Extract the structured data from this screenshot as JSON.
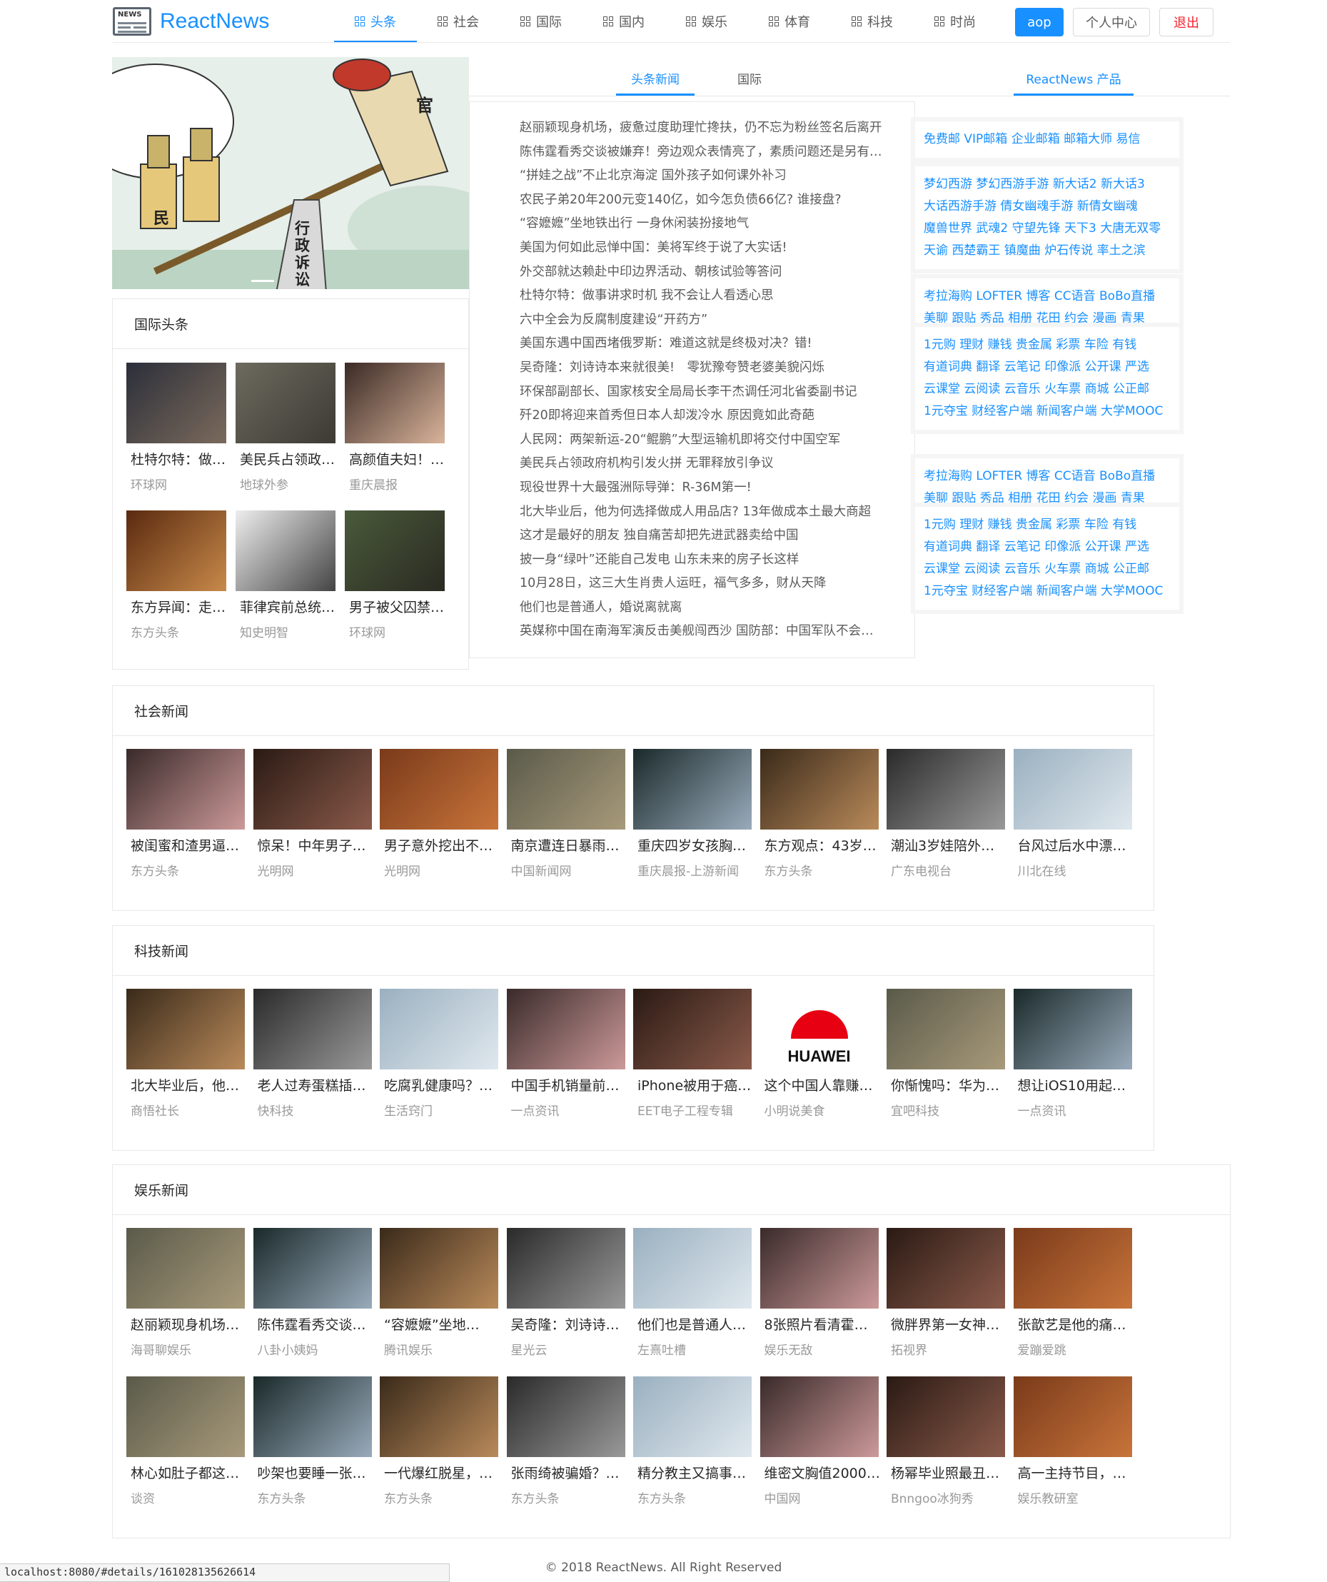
{
  "header": {
    "logo_badge": "NEWS",
    "logo_text": "ReactNews",
    "menu": [
      {
        "label": "头条",
        "active": true
      },
      {
        "label": "社会"
      },
      {
        "label": "国际"
      },
      {
        "label": "国内"
      },
      {
        "label": "娱乐"
      },
      {
        "label": "体育"
      },
      {
        "label": "科技"
      },
      {
        "label": "时尚"
      }
    ],
    "user_button": "aop",
    "center_button": "个人中心",
    "logout_button": "退出",
    "accent": "#1890ff"
  },
  "carousel": {
    "labels": [
      "官",
      "民",
      "行政诉讼"
    ]
  },
  "international": {
    "title": "国际头条",
    "items": [
      {
        "title": "杜特尔特：做…",
        "source": "环球网"
      },
      {
        "title": "美民兵占领政…",
        "source": "地球外参"
      },
      {
        "title": "高颜值夫妇！…",
        "source": "重庆晨报"
      },
      {
        "title": "东方异闻：走…",
        "source": "东方头条"
      },
      {
        "title": "菲律宾前总统…",
        "source": "知史明智"
      },
      {
        "title": "男子被父囚禁…",
        "source": "环球网"
      }
    ]
  },
  "center": {
    "tabs": [
      "头条新闻",
      "国际"
    ],
    "headlines": [
      "赵丽颖现身机场，疲惫过度助理忙搀扶，仍不忘为粉丝签名后离开",
      "陈伟霆看秀交谈被嫌弃！旁边观众表情亮了，素质问题还是另有隐情",
      "“拼娃之战”不止北京海淀 国外孩子如何课外补习",
      "农民子弟20年200元变140亿，如今怎负债66亿? 谁接盘?",
      "“容嬷嬷”坐地铁出行 一身休闲装扮接地气",
      "美国为何如此忌惮中国：美将军终于说了大实话!",
      "外交部就达赖赴中印边界活动、朝核试验等答问",
      "杜特尔特：做事讲求时机 我不会让人看透心思",
      "六中全会为反腐制度建设“开药方”",
      "美国东遇中国西堵俄罗斯：难道这就是终极对决？错!",
      "吴奇隆：刘诗诗本来就很美!　零犹豫夸赞老婆美貌闪烁",
      "环保部副部长、国家核安全局局长李干杰调任河北省委副书记",
      "歼20即将迎来首秀但日本人却泼冷水 原因竟如此奇葩",
      "人民网：两架新运-20“鲲鹏”大型运输机即将交付中国空军",
      "美民兵占领政府机构引发火拼 无罪释放引争议",
      "现役世界十大最强洲际导弹：R-36M第一!",
      "北大毕业后，他为何选择做成人用品店? 13年做成本土最大商超",
      "这才是最好的朋友 独自痛苦却把先进武器卖给中国",
      "披一身“绿叶”还能自己发电 山东未来的房子长这样",
      "10月28日，这三大生肖贵人运旺，福气多多，财从天降",
      "他们也是普通人，婚说离就离",
      "英媒称中国在南海军演反击美舰闯西沙 国防部：中国军队不会坐视不管"
    ]
  },
  "products": {
    "tab": "ReactNews 产品",
    "blocks": [
      [
        "免费邮  VIP邮箱  企业邮箱  邮箱大师  易信"
      ],
      [
        "梦幻西游  梦幻西游手游  新大话2  新大话3",
        "大话西游手游  倩女幽魂手游 新倩女幽魂",
        "魔兽世界 武魂2 守望先锋 天下3 大唐无双零",
        "天谕  西楚霸王 镇魔曲  炉石传说  率土之滨"
      ],
      [
        "考拉海购 LOFTER 博客 CC语音 BoBo直播",
        "美聊 跟贴 秀品 相册 花田 约会 漫画 青果"
      ],
      [
        "1元购  理财  赚钱  贵金属  彩票 车险 有钱",
        "有道词典  翻译  云笔记 印像派 公开课 严选",
        "云课堂  云阅读  云音乐 火车票 商城 公正邮",
        "1元夺宝  财经客户端 新闻客户端 大学MOOC"
      ],
      [
        "考拉海购 LOFTER 博客 CC语音 BoBo直播",
        "美聊 跟贴 秀品 相册 花田 约会 漫画 青果"
      ],
      [
        "1元购  理财  赚钱  贵金属  彩票 车险 有钱",
        "有道词典  翻译  云笔记 印像派 公开课 严选",
        "云课堂  云阅读  云音乐 火车票 商城 公正邮",
        "1元夺宝  财经客户端 新闻客户端 大学MOOC"
      ]
    ]
  },
  "social": {
    "title": "社会新闻",
    "items": [
      {
        "title": "被闺蜜和渣男逼…",
        "source": "东方头条"
      },
      {
        "title": "惊呆！中年男子…",
        "source": "光明网"
      },
      {
        "title": "男子意外挖出不…",
        "source": "光明网"
      },
      {
        "title": "南京遭连日暴雨…",
        "source": "中国新闻网"
      },
      {
        "title": "重庆四岁女孩胸…",
        "source": "重庆晨报-上游新闻"
      },
      {
        "title": "东方观点：43岁…",
        "source": "东方头条"
      },
      {
        "title": "潮汕3岁娃陪外…",
        "source": "广东电视台"
      },
      {
        "title": "台风过后水中漂…",
        "source": "川北在线"
      }
    ]
  },
  "tech": {
    "title": "科技新闻",
    "items": [
      {
        "title": "北大毕业后，他…",
        "source": "商悟社长"
      },
      {
        "title": "老人过寿蛋糕插…",
        "source": "快科技"
      },
      {
        "title": "吃腐乳健康吗？…",
        "source": "生活窍门"
      },
      {
        "title": "中国手机销量前…",
        "source": "一点资讯"
      },
      {
        "title": "iPhone被用于癌…",
        "source": "EET电子工程专辑"
      },
      {
        "title": "这个中国人靠赚…",
        "source": "小明说美食"
      },
      {
        "title": "你惭愧吗：华为…",
        "source": "宜吧科技"
      },
      {
        "title": "想让iOS10用起…",
        "source": "一点资讯"
      }
    ],
    "huawei_text": "HUAWEI"
  },
  "ent": {
    "title": "娱乐新闻",
    "items": [
      {
        "title": "赵丽颖现身机场…",
        "source": "海哥聊娱乐"
      },
      {
        "title": "陈伟霆看秀交谈…",
        "source": "八卦小姨妈"
      },
      {
        "title": "“容嬷嬷”坐地…",
        "source": "腾讯娱乐"
      },
      {
        "title": "吴奇隆：刘诗诗…",
        "source": "星光云"
      },
      {
        "title": "他们也是普通人…",
        "source": "左熹吐槽"
      },
      {
        "title": "8张照片看清霍…",
        "source": "娱乐无敌"
      },
      {
        "title": "微胖界第一女神…",
        "source": "拓视界"
      },
      {
        "title": "张歆艺是他的痛…",
        "source": "爱蹦爱跳"
      },
      {
        "title": "林心如肚子都这…",
        "source": "谈资"
      },
      {
        "title": "吵架也要睡一张…",
        "source": "东方头条"
      },
      {
        "title": "一代爆红脱星，…",
        "source": "东方头条"
      },
      {
        "title": "张雨绮被骗婚？…",
        "source": "东方头条"
      },
      {
        "title": "精分教主又搞事…",
        "source": "东方头条"
      },
      {
        "title": "维密文胸值2000…",
        "source": "中国网"
      },
      {
        "title": "杨幂毕业照最丑…",
        "source": "Bnngoo冰狗秀"
      },
      {
        "title": "高一主持节目，…",
        "source": "娱乐教研室"
      }
    ]
  },
  "footer": {
    "text": "© 2018 ReactNews. All Right Reserved"
  },
  "status_url": "localhost:8080/#details/161028135626614"
}
